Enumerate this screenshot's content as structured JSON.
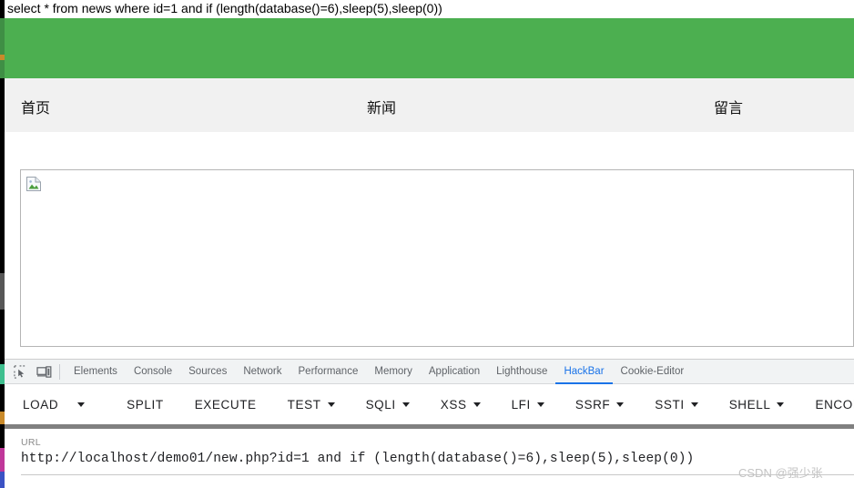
{
  "sql_preview": {
    "text": "select * from news where id=1 and if (length(database()=6),sleep(5),sleep(0))"
  },
  "site": {
    "banner_color": "#4caf50",
    "nav": {
      "items": [
        {
          "label": "首页"
        },
        {
          "label": "新闻"
        },
        {
          "label": "留言"
        }
      ]
    },
    "content": {
      "broken_image_alt": ""
    }
  },
  "devtools": {
    "icons": [
      {
        "name": "inspect-element-icon"
      },
      {
        "name": "device-toolbar-icon"
      }
    ],
    "tabs": [
      {
        "label": "Elements",
        "active": false
      },
      {
        "label": "Console",
        "active": false
      },
      {
        "label": "Sources",
        "active": false
      },
      {
        "label": "Network",
        "active": false
      },
      {
        "label": "Performance",
        "active": false
      },
      {
        "label": "Memory",
        "active": false
      },
      {
        "label": "Application",
        "active": false
      },
      {
        "label": "Lighthouse",
        "active": false
      },
      {
        "label": "HackBar",
        "active": true
      },
      {
        "label": "Cookie-Editor",
        "active": false
      }
    ],
    "active_tab": "HackBar",
    "active_tab_color": "#1a73e8"
  },
  "hackbar": {
    "buttons": [
      {
        "label": "LOAD",
        "has_caret": false
      },
      {
        "label": "SPLIT",
        "has_caret": false
      },
      {
        "label": "EXECUTE",
        "has_caret": false
      },
      {
        "label": "TEST",
        "has_caret": true
      },
      {
        "label": "SQLI",
        "has_caret": true
      },
      {
        "label": "XSS",
        "has_caret": true
      },
      {
        "label": "LFI",
        "has_caret": true
      },
      {
        "label": "SSRF",
        "has_caret": true
      },
      {
        "label": "SSTI",
        "has_caret": true
      },
      {
        "label": "SHELL",
        "has_caret": true
      },
      {
        "label": "ENCODING",
        "has_caret": false
      }
    ],
    "url_field": {
      "label": "URL",
      "value": "http://localhost/demo01/new.php?id=1 and if (length(database()=6),sleep(5),sleep(0))"
    }
  },
  "watermark": {
    "text": "CSDN @强少张"
  }
}
